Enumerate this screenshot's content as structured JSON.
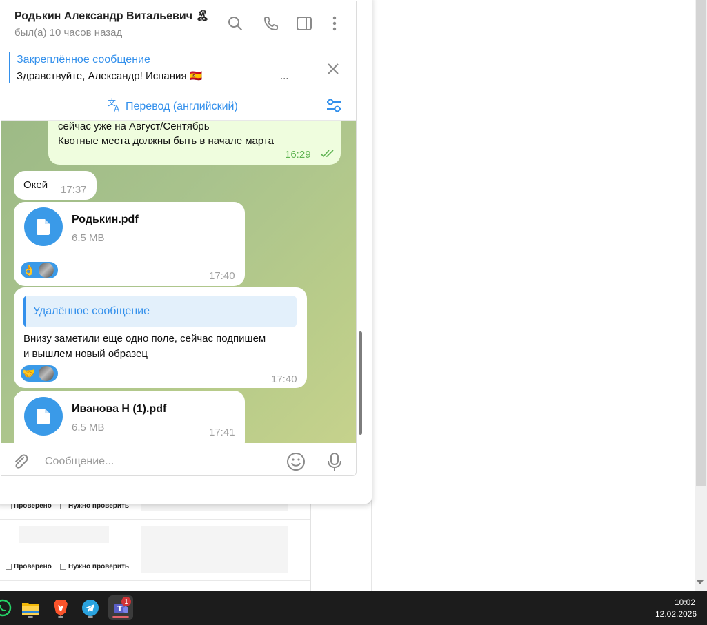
{
  "header": {
    "contact_name": "Родькин Александр Витальевич 🏝",
    "status": "был(а) 10 часов назад"
  },
  "pinned": {
    "title": "Закреплённое сообщение",
    "text": "Здравствуйте, Александр! Испания 🇪🇸 _____________..."
  },
  "translate": {
    "label": "Перевод (английский)"
  },
  "messages": [
    {
      "type": "text",
      "direction": "out",
      "lines": [
        "сейчас уже на Август/Сентябрь",
        "Квотные места должны быть в начале марта"
      ],
      "time": "16:29"
    },
    {
      "type": "text",
      "direction": "in",
      "text": "Окей",
      "time": "17:37"
    },
    {
      "type": "file",
      "direction": "in",
      "file_name": "Родькин.pdf",
      "file_size": "6.5 MB",
      "reaction": "👌",
      "time": "17:40"
    },
    {
      "type": "reply",
      "direction": "in",
      "reply_title": "Удалённое сообщение",
      "lines": [
        "Внизу заметили еще одно поле, сейчас подпишем",
        "и вышлем новый образец"
      ],
      "reaction": "🤝",
      "time": "17:40"
    },
    {
      "type": "file",
      "direction": "in",
      "file_name": "Иванова Н (1).pdf",
      "file_size": "6.5 MB",
      "time": "17:41"
    }
  ],
  "composer": {
    "placeholder": "Сообщение..."
  },
  "background_page": {
    "checkbox_checked_label": "Проверено",
    "checkbox_needs_label": "Нужно проверить"
  },
  "taskbar": {
    "time": "10:02",
    "date": "12.02.2026",
    "teams_badge": "1",
    "apps": [
      "whatsapp-icon",
      "file-explorer-icon",
      "brave-icon",
      "telegram-icon",
      "teams-icon"
    ]
  },
  "colors": {
    "accent": "#3390ec",
    "outgoing_bubble": "#effdde",
    "chat_background": "#a9c38d"
  }
}
